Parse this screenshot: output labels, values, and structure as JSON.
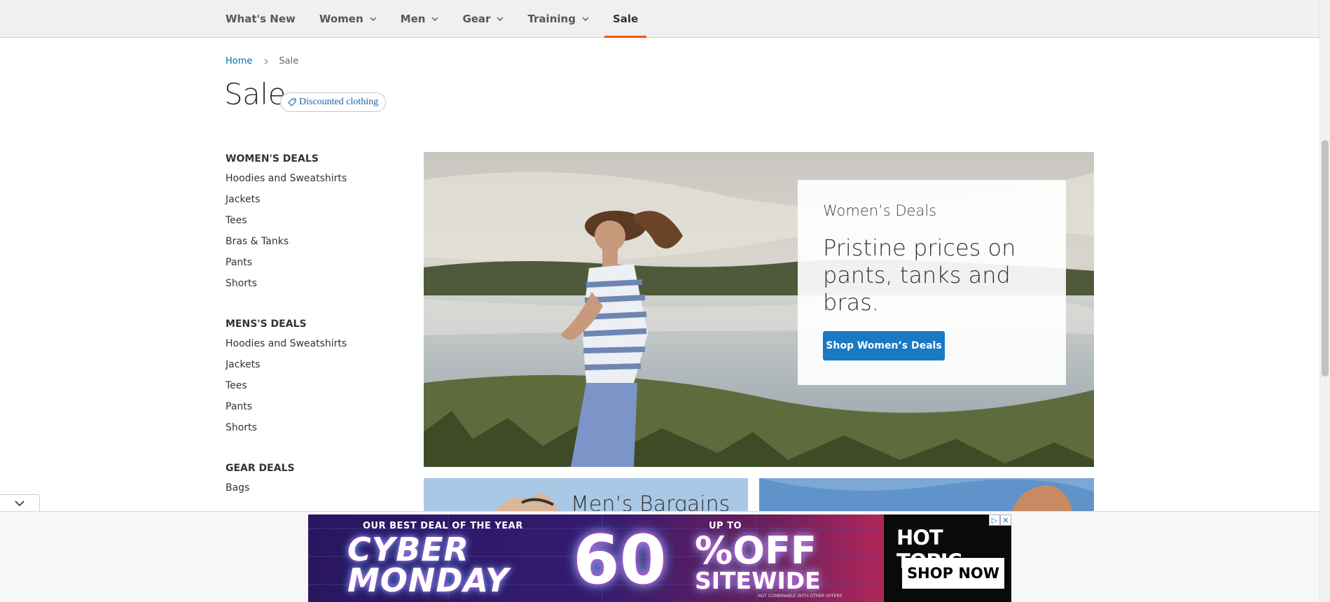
{
  "nav": {
    "items": [
      {
        "label": "What's New",
        "has_dropdown": false,
        "active": false
      },
      {
        "label": "Women",
        "has_dropdown": true,
        "active": false
      },
      {
        "label": "Men",
        "has_dropdown": true,
        "active": false
      },
      {
        "label": "Gear",
        "has_dropdown": true,
        "active": false
      },
      {
        "label": "Training",
        "has_dropdown": true,
        "active": false
      },
      {
        "label": "Sale",
        "has_dropdown": false,
        "active": true
      }
    ],
    "active_underline_color": "#ff5501"
  },
  "breadcrumb": {
    "home": "Home",
    "current": "Sale"
  },
  "page": {
    "title": "Sale",
    "tag": "Discounted clothing"
  },
  "sidebar": {
    "womens": {
      "heading": "WOMEN'S DEALS",
      "links": [
        "Hoodies and Sweatshirts",
        "Jackets",
        "Tees",
        "Bras & Tanks",
        "Pants",
        "Shorts"
      ]
    },
    "mens": {
      "heading": "MENS'S DEALS",
      "links": [
        "Hoodies and Sweatshirts",
        "Jackets",
        "Tees",
        "Pants",
        "Shorts"
      ]
    },
    "gear": {
      "heading": "GEAR DEALS",
      "links": [
        "Bags"
      ]
    }
  },
  "hero": {
    "eyebrow": "Women’s Deals",
    "headline": "Pristine prices on pants, tanks and bras.",
    "button": "Shop Women’s Deals",
    "button_color": "#1979c3"
  },
  "tiles": {
    "mens_label": "Men’s Bargains"
  },
  "ad": {
    "tagline": "OUR BEST DEAL OF THE YEAR",
    "cyber": "CYBER",
    "monday": "MONDAY",
    "up_to": "UP TO",
    "sixty": "60",
    "percent_off": "%OFF",
    "sitewide": "SITEWIDE",
    "fine_print": "NOT COMBINABLE WITH OTHER OFFERS",
    "brand": "HOT TOPIC",
    "cta": "SHOP NOW",
    "info_glyph": "▷",
    "close_glyph": "✕"
  }
}
